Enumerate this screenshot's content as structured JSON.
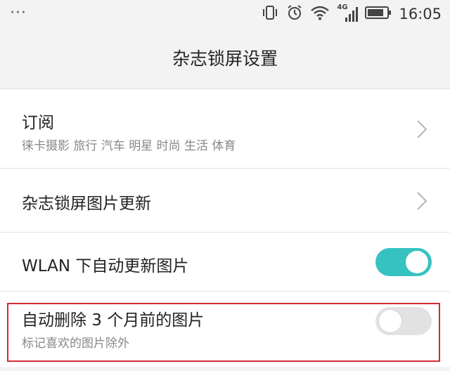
{
  "status_bar": {
    "dots": "···",
    "network_label": "4G",
    "time": "16:05"
  },
  "header": {
    "title": "杂志锁屏设置"
  },
  "settings": {
    "subscription": {
      "title": "订阅",
      "subtitle": "徕卡摄影 旅行 汽车 明星 时尚 生活 体育"
    },
    "update": {
      "title": "杂志锁屏图片更新"
    },
    "wlan_update": {
      "title": "WLAN 下自动更新图片",
      "enabled": true
    },
    "auto_delete": {
      "title": "自动删除 3 个月前的图片",
      "subtitle": "标记喜欢的图片除外",
      "enabled": false
    }
  },
  "colors": {
    "accent": "#37c2c2",
    "highlight": "#d42a35",
    "toggle_off": "#e2e2e2"
  }
}
